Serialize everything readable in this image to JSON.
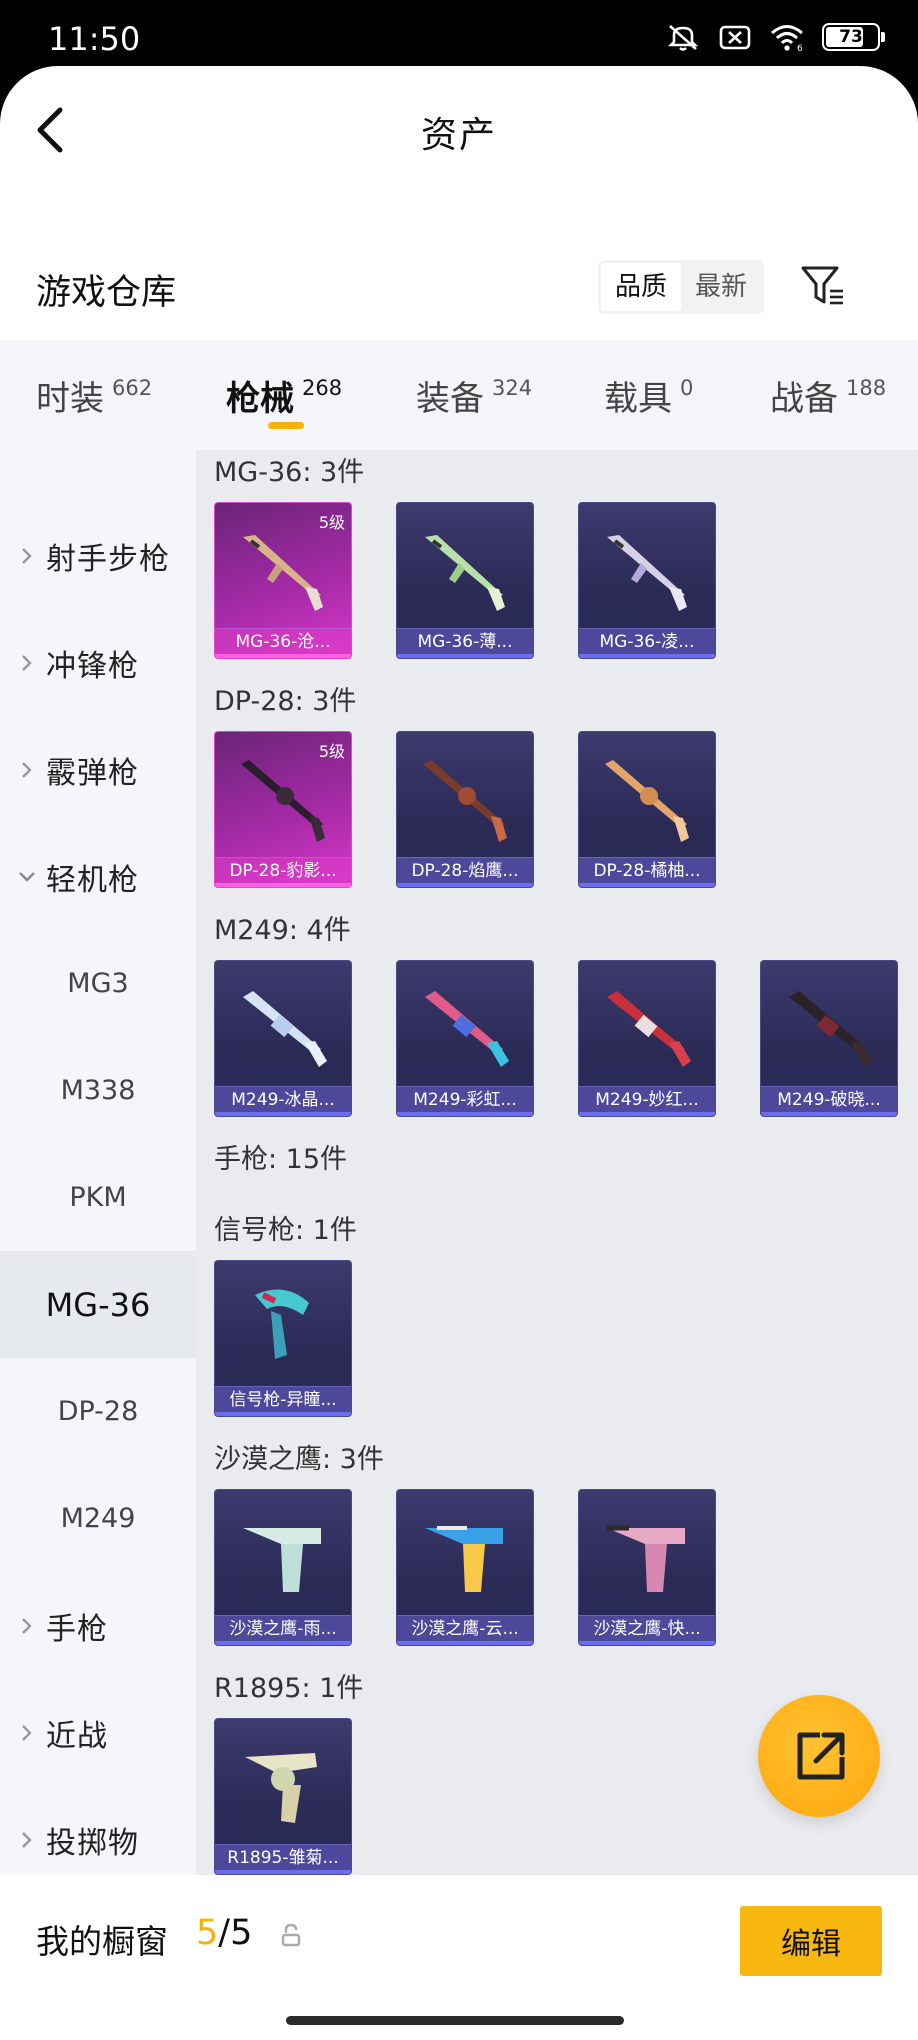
{
  "status_bar": {
    "time": "11:50",
    "battery": "73"
  },
  "header": {
    "title": "资产"
  },
  "warehouse": {
    "title": "游戏仓库",
    "sort_options": [
      "品质",
      "最新"
    ]
  },
  "tabs": [
    {
      "label": "时装",
      "count": "662"
    },
    {
      "label": "枪械",
      "count": "268"
    },
    {
      "label": "装备",
      "count": "324"
    },
    {
      "label": "载具",
      "count": "0"
    },
    {
      "label": "战备",
      "count": "188"
    }
  ],
  "sidebar": [
    {
      "label": "射手步枪"
    },
    {
      "label": "冲锋枪"
    },
    {
      "label": "霰弹枪"
    },
    {
      "label": "轻机枪"
    },
    {
      "label": "MG3"
    },
    {
      "label": "M338"
    },
    {
      "label": "PKM"
    },
    {
      "label": "MG-36"
    },
    {
      "label": "DP-28"
    },
    {
      "label": "M249"
    },
    {
      "label": "手枪"
    },
    {
      "label": "近战"
    },
    {
      "label": "投掷物"
    }
  ],
  "groups": [
    {
      "title": "MG-36: 3件",
      "items": [
        {
          "name": "MG-36-沧...",
          "level": "5级"
        },
        {
          "name": "MG-36-薄..."
        },
        {
          "name": "MG-36-凌..."
        }
      ]
    },
    {
      "title": "DP-28: 3件",
      "items": [
        {
          "name": "DP-28-豹影...",
          "level": "5级"
        },
        {
          "name": "DP-28-焰鹰..."
        },
        {
          "name": "DP-28-橘柚..."
        }
      ]
    },
    {
      "title": "M249: 4件",
      "items": [
        {
          "name": "M249-冰晶..."
        },
        {
          "name": "M249-彩虹..."
        },
        {
          "name": "M249-妙红..."
        },
        {
          "name": "M249-破晓..."
        }
      ]
    },
    {
      "title": "手枪: 15件",
      "items": []
    },
    {
      "title": "信号枪: 1件",
      "items": [
        {
          "name": "信号枪-异瞳..."
        }
      ]
    },
    {
      "title": "沙漠之鹰: 3件",
      "items": [
        {
          "name": "沙漠之鹰-雨..."
        },
        {
          "name": "沙漠之鹰-云..."
        },
        {
          "name": "沙漠之鹰-快..."
        }
      ]
    },
    {
      "title": "R1895: 1件",
      "items": [
        {
          "name": "R1895-雏菊..."
        }
      ]
    }
  ],
  "bottom": {
    "label": "我的橱窗",
    "current": "5",
    "total": "/5",
    "edit": "编辑"
  },
  "colors": {
    "accent": "#f5b20c",
    "epic": "#d838c8",
    "rare": "#3d3a6e"
  }
}
